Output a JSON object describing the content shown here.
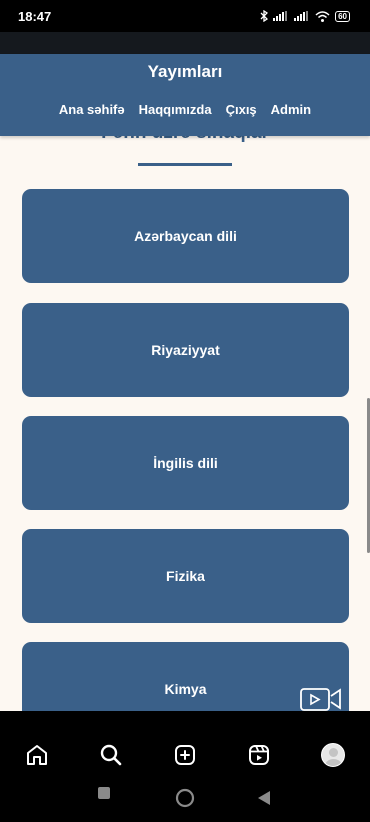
{
  "status_bar": {
    "time": "18:47",
    "battery": "60"
  },
  "header": {
    "title": "Yayımları",
    "nav": [
      "Ana səhifə",
      "Haqqımızda",
      "Çıxış",
      "Admin"
    ]
  },
  "section": {
    "title": "Fənn üzrə sınaqlar"
  },
  "subjects": [
    "Azərbaycan dili",
    "Riyaziyyat",
    "İngilis dili",
    "Fizika",
    "Kimya"
  ],
  "icons": {
    "home": "home-icon",
    "search": "search-icon",
    "create": "plus-square-icon",
    "reels": "reels-icon",
    "profile": "avatar-icon",
    "video": "video-call-icon"
  },
  "colors": {
    "primary": "#3a6089",
    "background": "#fdf8f2",
    "nav_bar": "#000000"
  }
}
